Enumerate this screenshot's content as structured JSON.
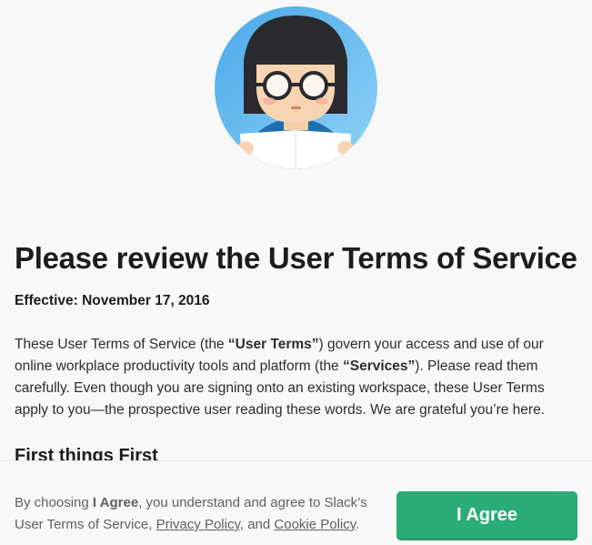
{
  "terms": {
    "title": "Please review the User Terms of Service",
    "effective_label": "Effective:",
    "effective_date": "November 17, 2016",
    "intro": {
      "p1": "These User Terms of Service (the ",
      "user_terms": "“User Terms”",
      "p2": ") govern your access and use of our online workplace productivity tools and platform (the ",
      "services": "“Services”",
      "p3": "). Please read them carefully. Even though you are signing onto an existing workspace, these User Terms apply to you—the prospective user reading these words. We are grateful you’re here."
    },
    "section_heading": "First things First"
  },
  "footer": {
    "t1": "By choosing ",
    "agree_bold": "I Agree",
    "t2": ", you understand and agree to Slack’s User Terms of Service, ",
    "privacy_link": "Privacy Policy",
    "t3": ", and ",
    "cookie_link": "Cookie Policy",
    "t4": ".",
    "agree_button": "I Agree"
  },
  "colors": {
    "accent_green": "#2bac76",
    "avatar_bg": "#5db8ec"
  }
}
